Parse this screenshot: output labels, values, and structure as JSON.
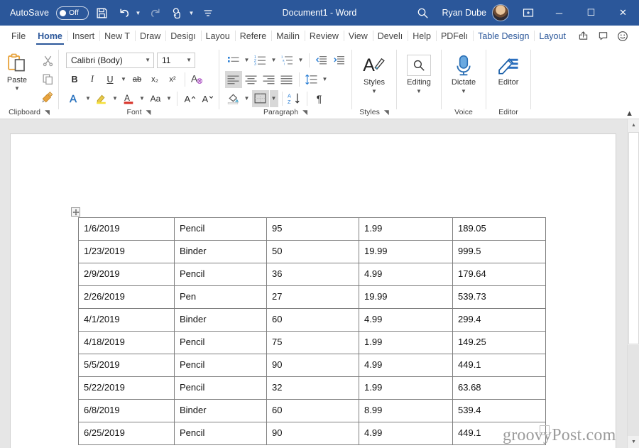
{
  "titlebar": {
    "autosave_label": "AutoSave",
    "autosave_state": "Off",
    "save_icon": "save-icon",
    "undo_icon": "undo-icon",
    "redo_icon": "redo-icon",
    "touch_icon": "touch-mode-icon",
    "more_icon": "more-commands-icon",
    "document_title": "Document1  -  Word",
    "search_icon": "search-icon",
    "account_name": "Ryan Dube",
    "ribbon_display_icon": "ribbon-display-options-icon",
    "minimize_label": "─",
    "maximize_label": "☐",
    "close_label": "✕"
  },
  "tabs": [
    {
      "label": "File",
      "kind": "file"
    },
    {
      "label": "Home",
      "kind": "active"
    },
    {
      "label": "Insert",
      "kind": "normal"
    },
    {
      "label": "New T",
      "kind": "normal"
    },
    {
      "label": "Draw",
      "kind": "normal"
    },
    {
      "label": "Desigı",
      "kind": "normal"
    },
    {
      "label": "Layou",
      "kind": "normal"
    },
    {
      "label": "Refere",
      "kind": "normal"
    },
    {
      "label": "Mailin",
      "kind": "normal"
    },
    {
      "label": "Review",
      "kind": "normal"
    },
    {
      "label": "View",
      "kind": "normal"
    },
    {
      "label": "Develı",
      "kind": "normal"
    },
    {
      "label": "Help",
      "kind": "normal"
    },
    {
      "label": "PDFelı",
      "kind": "normal"
    },
    {
      "label": "Table Design",
      "kind": "context"
    },
    {
      "label": "Layout",
      "kind": "context"
    }
  ],
  "tabstrip_right": {
    "share_icon": "share-icon",
    "comments_icon": "comments-icon",
    "feedback_icon": "smiley-feedback-icon"
  },
  "ribbon": {
    "clipboard": {
      "group_label": "Clipboard",
      "paste_label": "Paste",
      "paste_icon": "paste-icon",
      "cut_icon": "cut-scissors-icon",
      "copy_icon": "copy-icon",
      "format_painter_icon": "format-painter-icon",
      "dialog_launcher": "dialog-launcher-icon"
    },
    "font": {
      "group_label": "Font",
      "font_name": "Calibri (Body)",
      "font_size": "11",
      "bold": "B",
      "italic": "I",
      "underline": "U",
      "strikethrough": "ab",
      "subscript": "x₂",
      "superscript": "x²",
      "clear_formatting_icon": "clear-formatting-icon",
      "text_effects_icon": "text-effects-icon",
      "highlight_icon": "text-highlight-color-icon",
      "font_color_icon": "font-color-icon",
      "change_case": "Aa",
      "grow_font": "A",
      "shrink_font": "A",
      "dialog_launcher": "dialog-launcher-icon"
    },
    "paragraph": {
      "group_label": "Paragraph",
      "bullets_icon": "bullets-icon",
      "numbering_icon": "numbering-icon",
      "multilevel_icon": "multilevel-list-icon",
      "decrease_indent_icon": "decrease-indent-icon",
      "increase_indent_icon": "increase-indent-icon",
      "align_left_icon": "align-left-icon",
      "align_center_icon": "align-center-icon",
      "align_right_icon": "align-right-icon",
      "justify_icon": "justify-icon",
      "line_spacing_icon": "line-spacing-icon",
      "shading_icon": "shading-icon",
      "borders_icon": "borders-icon",
      "sort_icon": "sort-ascending-icon",
      "show_marks_icon": "show-formatting-marks-icon",
      "dialog_launcher": "dialog-launcher-icon"
    },
    "styles": {
      "group_label": "Styles",
      "button_label": "Styles",
      "icon": "styles-icon",
      "dialog_launcher": "dialog-launcher-icon"
    },
    "editing": {
      "button_label": "Editing",
      "icon": "find-magnifier-icon"
    },
    "voice": {
      "group_label": "Voice",
      "button_label": "Dictate",
      "icon": "microphone-icon"
    },
    "editor": {
      "group_label": "Editor",
      "button_label": "Editor",
      "icon": "editor-pen-icon"
    },
    "collapse_icon": "collapse-ribbon-chevron-icon"
  },
  "document": {
    "table_move_handle": "table-move-handle-icon",
    "end_of_table_marker": "end-of-table-marker",
    "watermark": "groovyPost.com",
    "table": {
      "rows": [
        {
          "date": "1/6/2019",
          "item": "Pencil",
          "qty": "95",
          "price": "1.99",
          "total": "189.05"
        },
        {
          "date": "1/23/2019",
          "item": "Binder",
          "qty": "50",
          "price": "19.99",
          "total": "999.5"
        },
        {
          "date": "2/9/2019",
          "item": "Pencil",
          "qty": "36",
          "price": "4.99",
          "total": "179.64"
        },
        {
          "date": "2/26/2019",
          "item": "Pen",
          "qty": "27",
          "price": "19.99",
          "total": "539.73"
        },
        {
          "date": "4/1/2019",
          "item": "Binder",
          "qty": "60",
          "price": "4.99",
          "total": "299.4"
        },
        {
          "date": "4/18/2019",
          "item": "Pencil",
          "qty": "75",
          "price": "1.99",
          "total": "149.25"
        },
        {
          "date": "5/5/2019",
          "item": "Pencil",
          "qty": "90",
          "price": "4.99",
          "total": "449.1"
        },
        {
          "date": "5/22/2019",
          "item": "Pencil",
          "qty": "32",
          "price": "1.99",
          "total": "63.68"
        },
        {
          "date": "6/8/2019",
          "item": "Binder",
          "qty": "60",
          "price": "8.99",
          "total": "539.4"
        },
        {
          "date": "6/25/2019",
          "item": "Pencil",
          "qty": "90",
          "price": "4.99",
          "total": "449.1"
        }
      ]
    }
  },
  "scrollbar": {
    "up_arrow": "▲",
    "down_arrow": "▼"
  },
  "colors": {
    "title_bar": "#2b579a",
    "accent": "#2b579a",
    "document_bg": "#e6e6e6",
    "table_border": "#7f7f7f"
  }
}
